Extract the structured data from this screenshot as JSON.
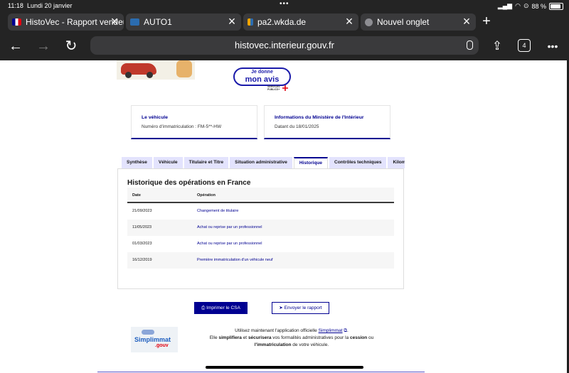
{
  "status": {
    "time": "11:18",
    "date": "Lundi 20 janvier",
    "dots": "•••",
    "battery": "88 %"
  },
  "tabs": [
    {
      "title": "HistoVec - Rapport vendeur",
      "favicon_color": "#000091",
      "active": true
    },
    {
      "title": "AUTO1",
      "favicon_color": "#2b6cb0",
      "active": false
    },
    {
      "title": "pa2.wkda.de",
      "favicon_color": "#f0a500",
      "active": false
    },
    {
      "title": "Nouvel onglet",
      "favicon_color": "#8e8e93",
      "active": false
    }
  ],
  "toolbar": {
    "url": "histovec.interieur.gouv.fr",
    "tab_count": "4"
  },
  "header": {
    "badge_line1": "Je donne",
    "badge_line2": "mon avis",
    "sp_line1": "SERVICES",
    "sp_line2": "PUBLICS+"
  },
  "cards": [
    {
      "heading": "Le véhicule",
      "value": "Numéro d'immatriculation : FM-5**-HW"
    },
    {
      "heading": "Informations du Ministère de l'Intérieur",
      "value": "Datant du 18/01/2025"
    }
  ],
  "page_tabs": [
    {
      "label": "Synthèse",
      "active": false
    },
    {
      "label": "Véhicule",
      "active": false
    },
    {
      "label": "Titulaire et Titre",
      "active": false
    },
    {
      "label": "Situation administrative",
      "active": false
    },
    {
      "label": "Historique",
      "active": true
    },
    {
      "label": "Contrôles techniques",
      "active": false
    },
    {
      "label": "Kilométrage",
      "active": false
    }
  ],
  "history": {
    "title": "Historique des opérations en France",
    "columns": [
      "Date",
      "Opération"
    ],
    "rows": [
      {
        "date": "21/09/2023",
        "operation": "Changement de titulaire"
      },
      {
        "date": "11/05/2023",
        "operation": "Achat ou reprise par un professionnel"
      },
      {
        "date": "01/03/2023",
        "operation": "Achat ou reprise par un professionnel"
      },
      {
        "date": "16/12/2019",
        "operation": "Première immatriculation d'un véhicule neuf"
      }
    ]
  },
  "actions": {
    "print": "Imprimer le CSA",
    "send": "Envoyer le rapport"
  },
  "promo": {
    "logo_main": "Simplimmat",
    "logo_sub": ".gouv",
    "line1_a": "Utilisez maintenant l'application officielle ",
    "line1_link": "Simplimmat",
    "line1_b": ".",
    "line2_a": "Elle ",
    "line2_b1": "simplifiera",
    "line2_c": " et ",
    "line2_b2": "sécurisera",
    "line2_d": " vos formalités administratives pour la ",
    "line2_b3": "cession",
    "line2_e": " ou",
    "line3_b": "l'immatriculation",
    "line3_c": " de votre véhicule."
  }
}
